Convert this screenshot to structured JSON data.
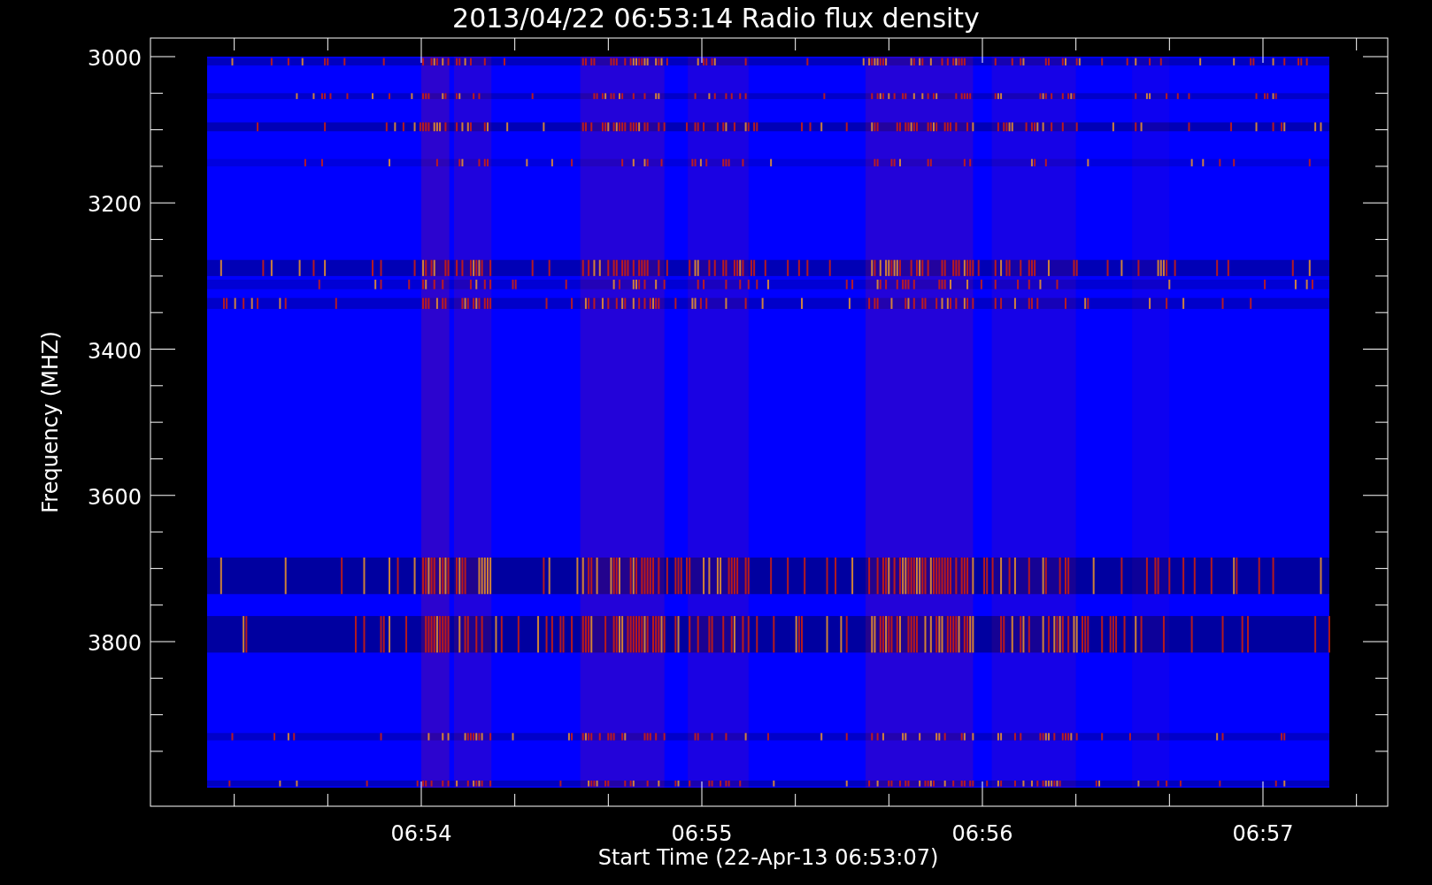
{
  "title": "2013/04/22 06:53:14 Radio flux density",
  "y_axis": {
    "label": "Frequency (MHZ)",
    "ticks": [
      "3000",
      "3200",
      "3400",
      "3600",
      "3800"
    ]
  },
  "x_axis": {
    "label": "Start Time (22-Apr-13 06:53:07)",
    "ticks": [
      "06:54",
      "06:55",
      "06:56",
      "06:57"
    ]
  }
}
